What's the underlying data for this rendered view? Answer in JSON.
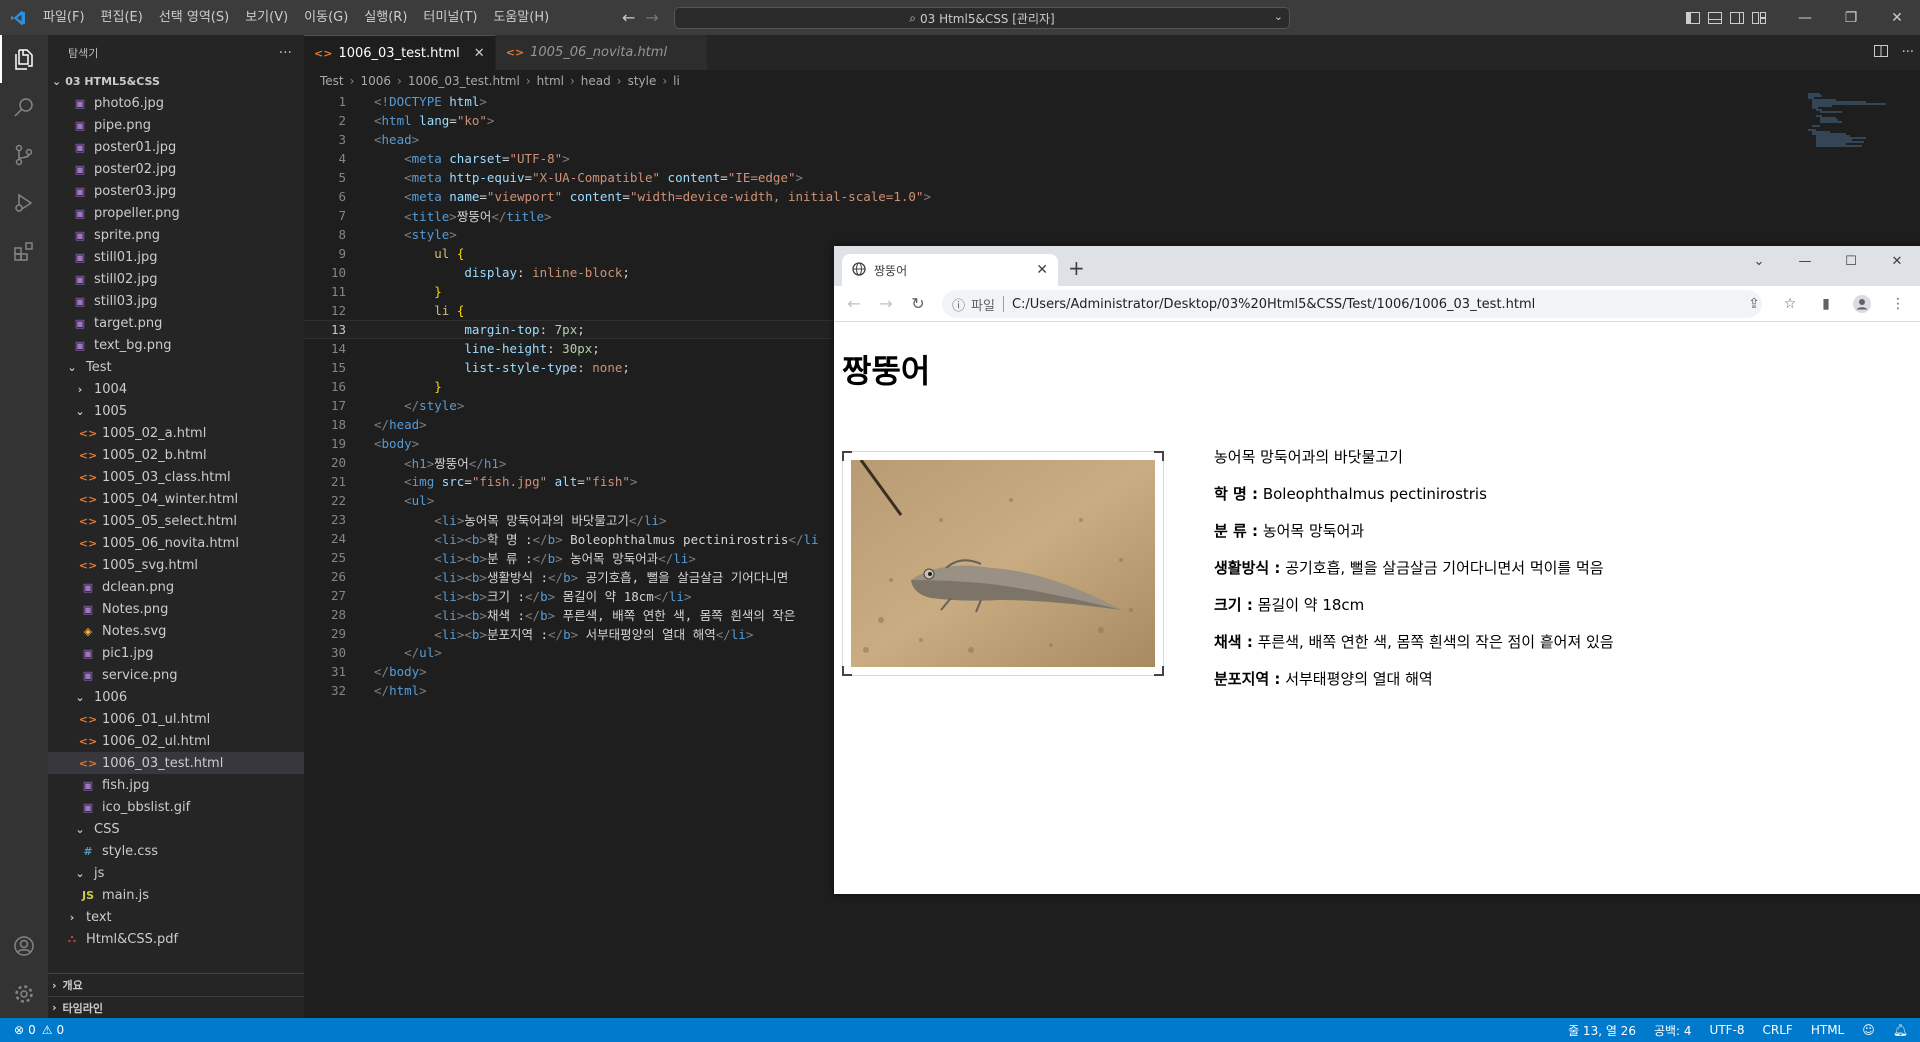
{
  "titlebar": {
    "menu": [
      "파일(F)",
      "편집(E)",
      "선택 영역(S)",
      "보기(V)",
      "이동(G)",
      "실행(R)",
      "터미널(T)",
      "도움말(H)"
    ],
    "command_center": "03 Html5&CSS [관리자]"
  },
  "sidebar": {
    "title": "탐색기",
    "root": "03 HTML5&CSS",
    "tree": [
      {
        "label": "photo6.jpg",
        "type": "image",
        "depth": 2
      },
      {
        "label": "pipe.png",
        "type": "image",
        "depth": 2
      },
      {
        "label": "poster01.jpg",
        "type": "image",
        "depth": 2
      },
      {
        "label": "poster02.jpg",
        "type": "image",
        "depth": 2
      },
      {
        "label": "poster03.jpg",
        "type": "image",
        "depth": 2
      },
      {
        "label": "propeller.png",
        "type": "image",
        "depth": 2
      },
      {
        "label": "sprite.png",
        "type": "image",
        "depth": 2
      },
      {
        "label": "still01.jpg",
        "type": "image",
        "depth": 2
      },
      {
        "label": "still02.jpg",
        "type": "image",
        "depth": 2
      },
      {
        "label": "still03.jpg",
        "type": "image",
        "depth": 2
      },
      {
        "label": "target.png",
        "type": "image",
        "depth": 2
      },
      {
        "label": "text_bg.png",
        "type": "image",
        "depth": 2
      },
      {
        "label": "Test",
        "type": "folder-open",
        "depth": 1
      },
      {
        "label": "1004",
        "type": "folder-closed",
        "depth": 2
      },
      {
        "label": "1005",
        "type": "folder-open",
        "depth": 2
      },
      {
        "label": "1005_02_a.html",
        "type": "html",
        "depth": 3
      },
      {
        "label": "1005_02_b.html",
        "type": "html",
        "depth": 3
      },
      {
        "label": "1005_03_class.html",
        "type": "html",
        "depth": 3
      },
      {
        "label": "1005_04_winter.html",
        "type": "html",
        "depth": 3
      },
      {
        "label": "1005_05_select.html",
        "type": "html",
        "depth": 3
      },
      {
        "label": "1005_06_novita.html",
        "type": "html",
        "depth": 3
      },
      {
        "label": "1005_svg.html",
        "type": "html",
        "depth": 3
      },
      {
        "label": "dclean.png",
        "type": "image",
        "depth": 3
      },
      {
        "label": "Notes.png",
        "type": "image",
        "depth": 3
      },
      {
        "label": "Notes.svg",
        "type": "svg",
        "depth": 3
      },
      {
        "label": "pic1.jpg",
        "type": "image",
        "depth": 3
      },
      {
        "label": "service.png",
        "type": "image",
        "depth": 3
      },
      {
        "label": "1006",
        "type": "folder-open",
        "depth": 2
      },
      {
        "label": "1006_01_ul.html",
        "type": "html",
        "depth": 3
      },
      {
        "label": "1006_02_ul.html",
        "type": "html",
        "depth": 3
      },
      {
        "label": "1006_03_test.html",
        "type": "html",
        "depth": 3,
        "selected": true
      },
      {
        "label": "fish.jpg",
        "type": "image",
        "depth": 3
      },
      {
        "label": "ico_bbslist.gif",
        "type": "image",
        "depth": 3
      },
      {
        "label": "CSS",
        "type": "folder-open",
        "depth": 2
      },
      {
        "label": "style.css",
        "type": "css",
        "depth": 3
      },
      {
        "label": "js",
        "type": "folder-open",
        "depth": 2
      },
      {
        "label": "main.js",
        "type": "js",
        "depth": 3
      },
      {
        "label": "text",
        "type": "folder-closed",
        "depth": 1
      },
      {
        "label": "Html&CSS.pdf",
        "type": "pdf",
        "depth": 1
      }
    ],
    "outline": "개요",
    "timeline": "타임라인"
  },
  "editor": {
    "tabs": [
      {
        "label": "1006_03_test.html",
        "active": true
      },
      {
        "label": "1005_06_novita.html",
        "active": false
      }
    ],
    "breadcrumb": [
      "Test",
      "1006",
      "1006_03_test.html",
      "html",
      "head",
      "style",
      "li"
    ],
    "current_line": 13,
    "lines": [
      [
        [
          "pu",
          "<!"
        ],
        [
          "tg",
          "DOCTYPE"
        ],
        [
          "tx",
          " "
        ],
        [
          "at",
          "html"
        ],
        [
          "pu",
          ">"
        ]
      ],
      [
        [
          "pu",
          "<"
        ],
        [
          "tg",
          "html"
        ],
        [
          "tx",
          " "
        ],
        [
          "at",
          "lang"
        ],
        [
          "tx",
          "="
        ],
        [
          "st",
          "\"ko\""
        ],
        [
          "pu",
          ">"
        ]
      ],
      [
        [
          "pu",
          "<"
        ],
        [
          "tg",
          "head"
        ],
        [
          "pu",
          ">"
        ]
      ],
      [
        [
          "tx",
          "    "
        ],
        [
          "pu",
          "<"
        ],
        [
          "tg",
          "meta"
        ],
        [
          "tx",
          " "
        ],
        [
          "at",
          "charset"
        ],
        [
          "tx",
          "="
        ],
        [
          "st",
          "\"UTF-8\""
        ],
        [
          "pu",
          ">"
        ]
      ],
      [
        [
          "tx",
          "    "
        ],
        [
          "pu",
          "<"
        ],
        [
          "tg",
          "meta"
        ],
        [
          "tx",
          " "
        ],
        [
          "at",
          "http-equiv"
        ],
        [
          "tx",
          "="
        ],
        [
          "st",
          "\"X-UA-Compatible\""
        ],
        [
          "tx",
          " "
        ],
        [
          "at",
          "content"
        ],
        [
          "tx",
          "="
        ],
        [
          "st",
          "\"IE=edge\""
        ],
        [
          "pu",
          ">"
        ]
      ],
      [
        [
          "tx",
          "    "
        ],
        [
          "pu",
          "<"
        ],
        [
          "tg",
          "meta"
        ],
        [
          "tx",
          " "
        ],
        [
          "at",
          "name"
        ],
        [
          "tx",
          "="
        ],
        [
          "st",
          "\"viewport\""
        ],
        [
          "tx",
          " "
        ],
        [
          "at",
          "content"
        ],
        [
          "tx",
          "="
        ],
        [
          "st",
          "\"width=device-width, initial-scale=1.0\""
        ],
        [
          "pu",
          ">"
        ]
      ],
      [
        [
          "tx",
          "    "
        ],
        [
          "pu",
          "<"
        ],
        [
          "tg",
          "title"
        ],
        [
          "pu",
          ">"
        ],
        [
          "tx",
          "짱뚱어"
        ],
        [
          "pu",
          "</"
        ],
        [
          "tg",
          "title"
        ],
        [
          "pu",
          ">"
        ]
      ],
      [
        [
          "tx",
          "    "
        ],
        [
          "pu",
          "<"
        ],
        [
          "tg",
          "style"
        ],
        [
          "pu",
          ">"
        ]
      ],
      [
        [
          "tx",
          "        "
        ],
        [
          "sel",
          "ul"
        ],
        [
          "tx",
          " "
        ],
        [
          "br",
          "{"
        ]
      ],
      [
        [
          "tx",
          "            "
        ],
        [
          "pr",
          "display"
        ],
        [
          "tx",
          ": "
        ],
        [
          "va",
          "inline-block"
        ],
        [
          "tx",
          ";"
        ]
      ],
      [
        [
          "tx",
          "        "
        ],
        [
          "br",
          "}"
        ]
      ],
      [
        [
          "tx",
          "        "
        ],
        [
          "sel",
          "li"
        ],
        [
          "tx",
          " "
        ],
        [
          "br",
          "{"
        ]
      ],
      [
        [
          "tx",
          "            "
        ],
        [
          "pr",
          "margin-top"
        ],
        [
          "tx",
          ": "
        ],
        [
          "nu",
          "7px"
        ],
        [
          "tx",
          ";"
        ]
      ],
      [
        [
          "tx",
          "            "
        ],
        [
          "pr",
          "line-height"
        ],
        [
          "tx",
          ": "
        ],
        [
          "nu",
          "30px"
        ],
        [
          "tx",
          ";"
        ]
      ],
      [
        [
          "tx",
          "            "
        ],
        [
          "pr",
          "list-style-type"
        ],
        [
          "tx",
          ": "
        ],
        [
          "va",
          "none"
        ],
        [
          "tx",
          ";"
        ]
      ],
      [
        [
          "tx",
          "        "
        ],
        [
          "br",
          "}"
        ]
      ],
      [
        [
          "tx",
          "    "
        ],
        [
          "pu",
          "</"
        ],
        [
          "tg",
          "style"
        ],
        [
          "pu",
          ">"
        ]
      ],
      [
        [
          "pu",
          "</"
        ],
        [
          "tg",
          "head"
        ],
        [
          "pu",
          ">"
        ]
      ],
      [
        [
          "pu",
          "<"
        ],
        [
          "tg",
          "body"
        ],
        [
          "pu",
          ">"
        ]
      ],
      [
        [
          "tx",
          "    "
        ],
        [
          "pu",
          "<"
        ],
        [
          "tg",
          "h1"
        ],
        [
          "pu",
          ">"
        ],
        [
          "tx",
          "짱뚱어"
        ],
        [
          "pu",
          "</"
        ],
        [
          "tg",
          "h1"
        ],
        [
          "pu",
          ">"
        ]
      ],
      [
        [
          "tx",
          "    "
        ],
        [
          "pu",
          "<"
        ],
        [
          "tg",
          "img"
        ],
        [
          "tx",
          " "
        ],
        [
          "at",
          "src"
        ],
        [
          "tx",
          "="
        ],
        [
          "st",
          "\"fish.jpg\""
        ],
        [
          "tx",
          " "
        ],
        [
          "at",
          "alt"
        ],
        [
          "tx",
          "="
        ],
        [
          "st",
          "\"fish\""
        ],
        [
          "pu",
          ">"
        ]
      ],
      [
        [
          "tx",
          "    "
        ],
        [
          "pu",
          "<"
        ],
        [
          "tg",
          "ul"
        ],
        [
          "pu",
          ">"
        ]
      ],
      [
        [
          "tx",
          "        "
        ],
        [
          "pu",
          "<"
        ],
        [
          "tg",
          "li"
        ],
        [
          "pu",
          ">"
        ],
        [
          "tx",
          "농어목 망둑어과의 바닷물고기"
        ],
        [
          "pu",
          "</"
        ],
        [
          "tg",
          "li"
        ],
        [
          "pu",
          ">"
        ]
      ],
      [
        [
          "tx",
          "        "
        ],
        [
          "pu",
          "<"
        ],
        [
          "tg",
          "li"
        ],
        [
          "pu",
          "><"
        ],
        [
          "tg",
          "b"
        ],
        [
          "pu",
          ">"
        ],
        [
          "tx",
          "학 명 :"
        ],
        [
          "pu",
          "</"
        ],
        [
          "tg",
          "b"
        ],
        [
          "pu",
          ">"
        ],
        [
          "tx",
          " Boleophthalmus pectinirostris"
        ],
        [
          "pu",
          "</"
        ],
        [
          "tg",
          "li"
        ]
      ],
      [
        [
          "tx",
          "        "
        ],
        [
          "pu",
          "<"
        ],
        [
          "tg",
          "li"
        ],
        [
          "pu",
          "><"
        ],
        [
          "tg",
          "b"
        ],
        [
          "pu",
          ">"
        ],
        [
          "tx",
          "분 류 :"
        ],
        [
          "pu",
          "</"
        ],
        [
          "tg",
          "b"
        ],
        [
          "pu",
          ">"
        ],
        [
          "tx",
          " 농어목 망둑어과"
        ],
        [
          "pu",
          "</"
        ],
        [
          "tg",
          "li"
        ],
        [
          "pu",
          ">"
        ]
      ],
      [
        [
          "tx",
          "        "
        ],
        [
          "pu",
          "<"
        ],
        [
          "tg",
          "li"
        ],
        [
          "pu",
          "><"
        ],
        [
          "tg",
          "b"
        ],
        [
          "pu",
          ">"
        ],
        [
          "tx",
          "생활방식 :"
        ],
        [
          "pu",
          "</"
        ],
        [
          "tg",
          "b"
        ],
        [
          "pu",
          ">"
        ],
        [
          "tx",
          " 공기호흡, 뻘을 살금살금 기어다니면"
        ]
      ],
      [
        [
          "tx",
          "        "
        ],
        [
          "pu",
          "<"
        ],
        [
          "tg",
          "li"
        ],
        [
          "pu",
          "><"
        ],
        [
          "tg",
          "b"
        ],
        [
          "pu",
          ">"
        ],
        [
          "tx",
          "크기 :"
        ],
        [
          "pu",
          "</"
        ],
        [
          "tg",
          "b"
        ],
        [
          "pu",
          ">"
        ],
        [
          "tx",
          " 몸길이 약 18cm"
        ],
        [
          "pu",
          "</"
        ],
        [
          "tg",
          "li"
        ],
        [
          "pu",
          ">"
        ]
      ],
      [
        [
          "tx",
          "        "
        ],
        [
          "pu",
          "<"
        ],
        [
          "tg",
          "li"
        ],
        [
          "pu",
          "><"
        ],
        [
          "tg",
          "b"
        ],
        [
          "pu",
          ">"
        ],
        [
          "tx",
          "채색 :"
        ],
        [
          "pu",
          "</"
        ],
        [
          "tg",
          "b"
        ],
        [
          "pu",
          ">"
        ],
        [
          "tx",
          " 푸른색, 배쪽 연한 색, 몸쪽 흰색의 작은"
        ]
      ],
      [
        [
          "tx",
          "        "
        ],
        [
          "pu",
          "<"
        ],
        [
          "tg",
          "li"
        ],
        [
          "pu",
          "><"
        ],
        [
          "tg",
          "b"
        ],
        [
          "pu",
          ">"
        ],
        [
          "tx",
          "분포지역 :"
        ],
        [
          "pu",
          "</"
        ],
        [
          "tg",
          "b"
        ],
        [
          "pu",
          ">"
        ],
        [
          "tx",
          " 서부태평양의 열대 해역"
        ],
        [
          "pu",
          "</"
        ],
        [
          "tg",
          "li"
        ],
        [
          "pu",
          ">"
        ]
      ],
      [
        [
          "tx",
          "    "
        ],
        [
          "pu",
          "</"
        ],
        [
          "tg",
          "ul"
        ],
        [
          "pu",
          ">"
        ]
      ],
      [
        [
          "pu",
          "</"
        ],
        [
          "tg",
          "body"
        ],
        [
          "pu",
          ">"
        ]
      ],
      [
        [
          "pu",
          "</"
        ],
        [
          "tg",
          "html"
        ],
        [
          "pu",
          ">"
        ]
      ]
    ]
  },
  "statusbar": {
    "errors": "0",
    "warnings": "0",
    "position": "줄 13, 열 26",
    "spaces": "공백: 4",
    "encoding": "UTF-8",
    "eol": "CRLF",
    "language": "HTML"
  },
  "browser": {
    "tab_title": "짱뚱어",
    "scheme_label": "파일",
    "url": "C:/Users/Administrator/Desktop/03%20Html5&CSS/Test/1006/1006_03_test.html",
    "page": {
      "heading": "짱뚱어",
      "img_alt": "fish",
      "items": [
        {
          "b": "",
          "text": "농어목 망둑어과의 바닷물고기"
        },
        {
          "b": "학 명 :",
          "text": " Boleophthalmus pectinirostris"
        },
        {
          "b": "분 류 :",
          "text": " 농어목 망둑어과"
        },
        {
          "b": "생활방식 :",
          "text": " 공기호흡, 뻘을 살금살금 기어다니면서 먹이를 먹음"
        },
        {
          "b": "크기 :",
          "text": " 몸길이 약 18cm"
        },
        {
          "b": "채색 :",
          "text": " 푸른색, 배쪽 연한 색, 몸쪽 흰색의 작은 점이 흩어져 있음"
        },
        {
          "b": "분포지역 :",
          "text": " 서부태평양의 열대 해역"
        }
      ]
    }
  }
}
